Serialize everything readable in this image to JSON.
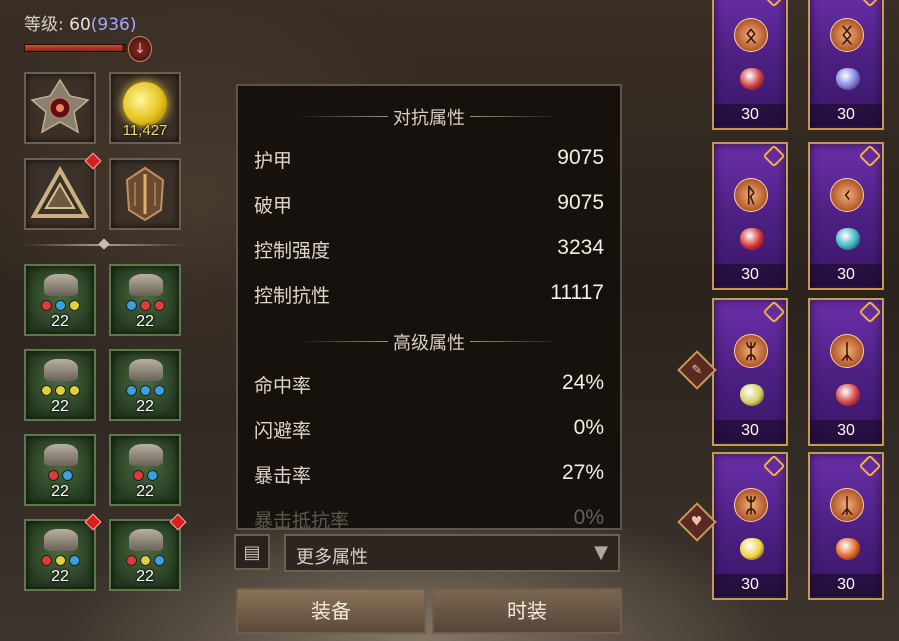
{
  "header": {
    "level_label": "等级: ",
    "level_value": "60",
    "level_extra": "(936)",
    "xp_progress": 0.97
  },
  "left_slots": [
    {
      "name": "gear-emblem-slot",
      "count": ""
    },
    {
      "name": "gold-orb-slot",
      "count": "11,427"
    },
    {
      "name": "rune-triangle-slot",
      "count": "",
      "alert": true
    },
    {
      "name": "crest-slot",
      "count": ""
    }
  ],
  "gear_slots": [
    {
      "name": "helm-slot",
      "count": "22",
      "gems": [
        "#e03a3a",
        "#3aa0e0",
        "#e0d03a"
      ]
    },
    {
      "name": "belt-slot",
      "count": "22",
      "gems": [
        "#3aa0e0",
        "#e03a3a",
        "#e03a3a"
      ]
    },
    {
      "name": "gloves-slot",
      "count": "22",
      "gems": [
        "#e0d03a",
        "#e0d03a",
        "#e0d03a"
      ]
    },
    {
      "name": "boots-slot",
      "count": "22",
      "gems": [
        "#3aa0e0",
        "#3aa0e0",
        "#3aa0e0"
      ]
    },
    {
      "name": "ring-left-slot",
      "count": "22",
      "gems": [
        "#e03a3a",
        "#3aa0e0"
      ]
    },
    {
      "name": "ring-right-slot",
      "count": "22",
      "gems": [
        "#e03a3a",
        "#3aa0e0"
      ]
    },
    {
      "name": "amulet-left-slot",
      "count": "22",
      "gems": [
        "#e03a3a",
        "#e0d03a",
        "#3aa0e0"
      ],
      "alert": true
    },
    {
      "name": "amulet-right-slot",
      "count": "22",
      "gems": [
        "#e03a3a",
        "#e0d03a",
        "#3aa0e0"
      ],
      "alert": true
    }
  ],
  "panel": {
    "section1_title": "对抗属性",
    "section2_title": "高级属性",
    "stats1": [
      {
        "label": "护甲",
        "value": "9075"
      },
      {
        "label": "破甲",
        "value": "9075"
      },
      {
        "label": "控制强度",
        "value": "3234"
      },
      {
        "label": "控制抗性",
        "value": "11117"
      }
    ],
    "stats2": [
      {
        "label": "命中率",
        "value": "24%"
      },
      {
        "label": "闪避率",
        "value": "0%"
      },
      {
        "label": "暴击率",
        "value": "27%"
      },
      {
        "label": "暴击抵抗率",
        "value": "0%"
      }
    ]
  },
  "more": {
    "label": "更多属性",
    "chevron": "▼"
  },
  "tabs": {
    "equip": "装备",
    "fashion": "时装"
  },
  "cards": [
    {
      "level": "30",
      "rune": "ᛟ",
      "item_color": "#c83a3a"
    },
    {
      "level": "30",
      "rune": "ᛝ",
      "item_color": "#7a7adf"
    },
    {
      "level": "30",
      "rune": "ᚱ",
      "item_color": "#d03030"
    },
    {
      "level": "30",
      "rune": "ᚲ",
      "item_color": "#3ab0c0"
    },
    {
      "level": "30",
      "rune": "ᛯ",
      "item_color": "#d0d060"
    },
    {
      "level": "30",
      "rune": "ᛣ",
      "item_color": "#d04040"
    },
    {
      "level": "30",
      "rune": "ᛯ",
      "item_color": "#f0d040"
    },
    {
      "level": "30",
      "rune": "ᛣ",
      "item_color": "#e06020"
    }
  ]
}
